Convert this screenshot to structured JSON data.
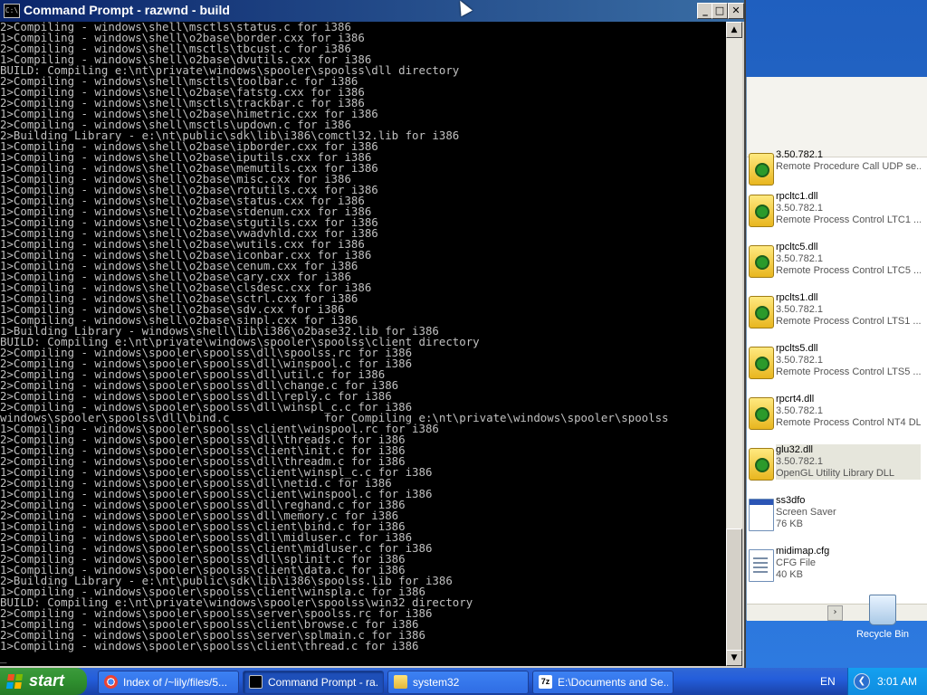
{
  "window": {
    "title": "Command Prompt - razwnd - build",
    "app_icon_text": "C:\\",
    "buttons": {
      "minimize": "_",
      "maximize": "□",
      "close": "✕"
    }
  },
  "console_lines": [
    "2>Compiling - windows\\shell\\msctls\\status.c for i386",
    "1>Compiling - windows\\shell\\o2base\\border.cxx for i386",
    "2>Compiling - windows\\shell\\msctls\\tbcust.c for i386",
    "1>Compiling - windows\\shell\\o2base\\dvutils.cxx for i386",
    "BUILD: Compiling e:\\nt\\private\\windows\\spooler\\spoolss\\dll directory",
    "2>Compiling - windows\\shell\\msctls\\toolbar.c for i386",
    "1>Compiling - windows\\shell\\o2base\\fatstg.cxx for i386",
    "2>Compiling - windows\\shell\\msctls\\trackbar.c for i386",
    "1>Compiling - windows\\shell\\o2base\\himetric.cxx for i386",
    "2>Compiling - windows\\shell\\msctls\\updown.c for i386",
    "2>Building Library - e:\\nt\\public\\sdk\\lib\\i386\\comctl32.lib for i386",
    "1>Compiling - windows\\shell\\o2base\\ipborder.cxx for i386",
    "1>Compiling - windows\\shell\\o2base\\iputils.cxx for i386",
    "1>Compiling - windows\\shell\\o2base\\memutils.cxx for i386",
    "1>Compiling - windows\\shell\\o2base\\misc.cxx for i386",
    "1>Compiling - windows\\shell\\o2base\\rotutils.cxx for i386",
    "1>Compiling - windows\\shell\\o2base\\status.cxx for i386",
    "1>Compiling - windows\\shell\\o2base\\stdenum.cxx for i386",
    "1>Compiling - windows\\shell\\o2base\\stgutils.cxx for i386",
    "1>Compiling - windows\\shell\\o2base\\vwadvhld.cxx for i386",
    "1>Compiling - windows\\shell\\o2base\\wutils.cxx for i386",
    "1>Compiling - windows\\shell\\o2base\\iconbar.cxx for i386",
    "1>Compiling - windows\\shell\\o2base\\cenum.cxx for i386",
    "1>Compiling - windows\\shell\\o2base\\cary.cxx for i386",
    "1>Compiling - windows\\shell\\o2base\\clsdesc.cxx for i386",
    "1>Compiling - windows\\shell\\o2base\\sctrl.cxx for i386",
    "1>Compiling - windows\\shell\\o2base\\sdv.cxx for i386",
    "1>Compiling - windows\\shell\\o2base\\sinpl.cxx for i386",
    "1>Building Library - windows\\shell\\lib\\i386\\o2base32.lib for i386",
    "BUILD: Compiling e:\\nt\\private\\windows\\spooler\\spoolss\\client directory",
    "2>Compiling - windows\\spooler\\spoolss\\dll\\spoolss.rc for i386",
    "2>Compiling - windows\\spooler\\spoolss\\dll\\winspool.c for i386",
    "2>Compiling - windows\\spooler\\spoolss\\dll\\util.c for i386",
    "2>Compiling - windows\\spooler\\spoolss\\dll\\change.c for i386",
    "2>Compiling - windows\\spooler\\spoolss\\dll\\reply.c for i386",
    "2>Compiling - windows\\spooler\\spoolss\\dll\\winspl_c.c for i386",
    "windows\\spooler\\spoolss\\dll\\bind.c              for Compiling e:\\nt\\private\\windows\\spooler\\spoolss",
    "1>Compiling - windows\\spooler\\spoolss\\client\\winspool.rc for i386",
    "2>Compiling - windows\\spooler\\spoolss\\dll\\threads.c for i386",
    "1>Compiling - windows\\spooler\\spoolss\\client\\init.c for i386",
    "2>Compiling - windows\\spooler\\spoolss\\dll\\threadm.c for i386",
    "1>Compiling - windows\\spooler\\spoolss\\client\\winspl_c.c for i386",
    "2>Compiling - windows\\spooler\\spoolss\\dll\\netid.c for i386",
    "1>Compiling - windows\\spooler\\spoolss\\client\\winspool.c for i386",
    "2>Compiling - windows\\spooler\\spoolss\\dll\\reghand.c for i386",
    "2>Compiling - windows\\spooler\\spoolss\\dll\\memory.c for i386",
    "1>Compiling - windows\\spooler\\spoolss\\client\\bind.c for i386",
    "2>Compiling - windows\\spooler\\spoolss\\dll\\midluser.c for i386",
    "1>Compiling - windows\\spooler\\spoolss\\client\\midluser.c for i386",
    "2>Compiling - windows\\spooler\\spoolss\\dll\\splinit.c for i386",
    "1>Compiling - windows\\spooler\\spoolss\\client\\data.c for i386",
    "2>Building Library - e:\\nt\\public\\sdk\\lib\\i386\\spoolss.lib for i386",
    "1>Compiling - windows\\spooler\\spoolss\\client\\winspla.c for i386",
    "BUILD: Compiling e:\\nt\\private\\windows\\spooler\\spoolss\\win32 directory",
    "2>Compiling - windows\\spooler\\spoolss\\server\\spoolss.rc for i386",
    "1>Compiling - windows\\spooler\\spoolss\\client\\browse.c for i386",
    "2>Compiling - windows\\spooler\\spoolss\\server\\splmain.c for i386",
    "1>Compiling - windows\\spooler\\spoolss\\client\\thread.c for i386",
    "_"
  ],
  "scrollbar": {
    "up": "▲",
    "down": "▼"
  },
  "explorer_files": [
    {
      "name": "3.50.782.1",
      "version": "",
      "desc": "Remote Procedure Call UDP se...",
      "icon": "dll-icon"
    },
    {
      "name": "rpcltc1.dll",
      "version": "3.50.782.1",
      "desc": "Remote Process Control LTC1 ...",
      "icon": "dll-icon"
    },
    {
      "name": "rpcltc5.dll",
      "version": "3.50.782.1",
      "desc": "Remote Process Control LTC5 ...",
      "icon": "dll-icon"
    },
    {
      "name": "rpclts1.dll",
      "version": "3.50.782.1",
      "desc": "Remote Process Control LTS1 ...",
      "icon": "dll-icon"
    },
    {
      "name": "rpclts5.dll",
      "version": "3.50.782.1",
      "desc": "Remote Process Control LTS5 ...",
      "icon": "dll-icon"
    },
    {
      "name": "rpcrt4.dll",
      "version": "3.50.782.1",
      "desc": "Remote Process Control NT4 DLL",
      "icon": "dll-icon"
    },
    {
      "name": "glu32.dll",
      "version": "3.50.782.1",
      "desc": "OpenGL Utility Library DLL",
      "icon": "dll-icon"
    },
    {
      "name": "ss3dfo",
      "version": "Screen Saver",
      "desc": "76 KB",
      "icon": "screensaver-icon"
    },
    {
      "name": "midimap.cfg",
      "version": "CFG File",
      "desc": "40 KB",
      "icon": "cfg-file-icon"
    }
  ],
  "explorer_scroll_arrow": "›",
  "desktop": {
    "recycle_bin": "Recycle Bin"
  },
  "taskbar": {
    "start": "start",
    "tasks": [
      {
        "label": "Index of /~lily/files/5...",
        "icon": "chrome-icon"
      },
      {
        "label": "Command Prompt - ra...",
        "icon": "cmd-icon"
      },
      {
        "label": "system32",
        "icon": "folder-icon"
      },
      {
        "label": "E:\\Documents and Se...",
        "icon": "7zip-icon",
        "icon_text": "7z"
      }
    ],
    "language": "EN",
    "tray_arrow": "❮",
    "clock": "3:01 AM"
  }
}
